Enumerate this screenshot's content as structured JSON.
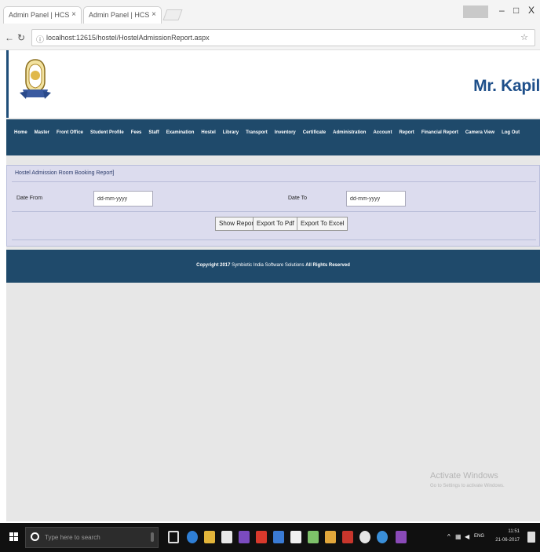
{
  "browser": {
    "tabs": [
      {
        "title": "Admin Panel | HCS"
      },
      {
        "title": "Admin Panel | HCS"
      }
    ],
    "address": "localhost:12615/hostel/HostelAdmissionReport.aspx",
    "window_controls": {
      "minimize": "–",
      "maximize": "□",
      "close": "X"
    }
  },
  "header": {
    "user_name": "Mr. Kapil"
  },
  "menu": {
    "items": [
      "Home",
      "Master",
      "Front Office",
      "Student Profile",
      "Fees",
      "Staff",
      "Examination",
      "Hostel",
      "Library",
      "Transport",
      "Inventory",
      "Certificate",
      "Administration",
      "Account",
      "Report",
      "Financial Report",
      "Camera View",
      "Log Out"
    ]
  },
  "report": {
    "title": "Hostel Admission Room Booking Report]",
    "date_from_label": "Date From",
    "date_from_value": "dd-mm-yyyy",
    "date_to_label": "Date To",
    "date_to_value": "dd-mm-yyyy",
    "show_report_label": "Show Report",
    "export_pdf_label": "Export To Pdf",
    "export_excel_label": "Export To Excel"
  },
  "footer": {
    "copyright_prefix": "Copyright 2017",
    "company": "Symbiotic India Software Solutions",
    "rights": "All Rights Reserved"
  },
  "watermark": {
    "line1": "Activate Windows",
    "line2": "Go to Settings to activate Windows."
  },
  "taskbar": {
    "search_placeholder": "Type here to search",
    "time": "11:51",
    "date": "21-06-2017",
    "language": "ENG"
  },
  "colors": {
    "menu_bg": "#1f4a6b",
    "panel_bg": "#dcdcee",
    "name_color": "#1e4f8a"
  }
}
